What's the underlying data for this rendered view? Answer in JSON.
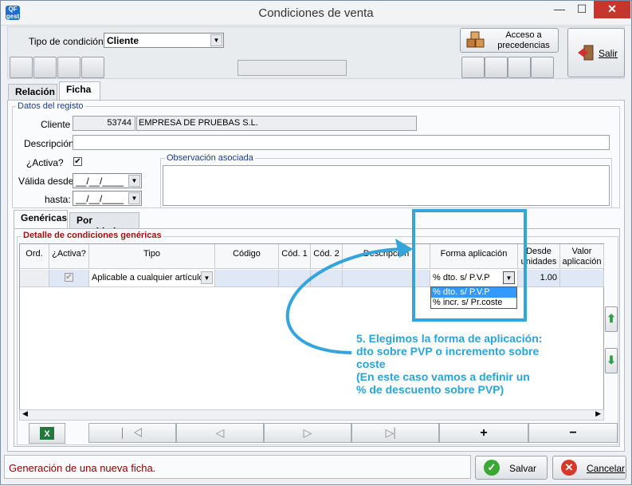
{
  "window": {
    "title": "Condiciones de venta",
    "app_icon_text": "QF gest"
  },
  "toolbar": {
    "tipo_label": "Tipo de condición:",
    "tipo_value": "Cliente",
    "acceso_label": "Acceso a precedencias",
    "salir_label": "Salir"
  },
  "tabs_top": [
    "Relación",
    "Ficha"
  ],
  "datos": {
    "group_title": "Datos del registo",
    "cliente_label": "Cliente",
    "cliente_code": "53744",
    "cliente_name": "EMPRESA DE PRUEBAS S.L.",
    "descripcion_label": "Descripción",
    "activa_label": "¿Activa?",
    "activa_checked": "✔",
    "valida_desde_label": "Válida desde:",
    "hasta_label": "hasta:",
    "date_placeholder": "__/__/____",
    "observacion_title": "Observación asociada"
  },
  "tabs_inner": [
    "Genéricas",
    "Por cantidad"
  ],
  "detalle": {
    "group_title": "Detalle de condiciones genéricas",
    "columns": [
      "Ord.",
      "¿Activa?",
      "Tipo",
      "Código",
      "Cód. 1",
      "Cód. 2",
      "Descripción",
      "Forma aplicación",
      "Desde unidades",
      "Valor aplicación"
    ],
    "row": {
      "tipo": "Aplicable a cualquier artículo",
      "forma": "% dto. s/ P.V.P",
      "desde": "1.00"
    },
    "dropdown_options": [
      "% dto. s/ P.V.P",
      "% incr. s/ Pr.coste"
    ]
  },
  "bottom_bar": {
    "first": "⎸◁",
    "prev": "◁",
    "next": "▷",
    "last": "▷⎸",
    "add": "+",
    "remove": "−"
  },
  "status": {
    "message": "Generación de una nueva ficha."
  },
  "actions": {
    "save": "Salvar",
    "cancel": "Cancelar"
  },
  "annotation": {
    "line1": "5. Elegimos la forma de aplicación:",
    "line2": "dto sobre PVP o incremento sobre",
    "line3": "coste",
    "line4": "(En este caso vamos a definir un",
    "line5": "% de descuento sobre PVP)",
    "color": "#34a5dc"
  }
}
